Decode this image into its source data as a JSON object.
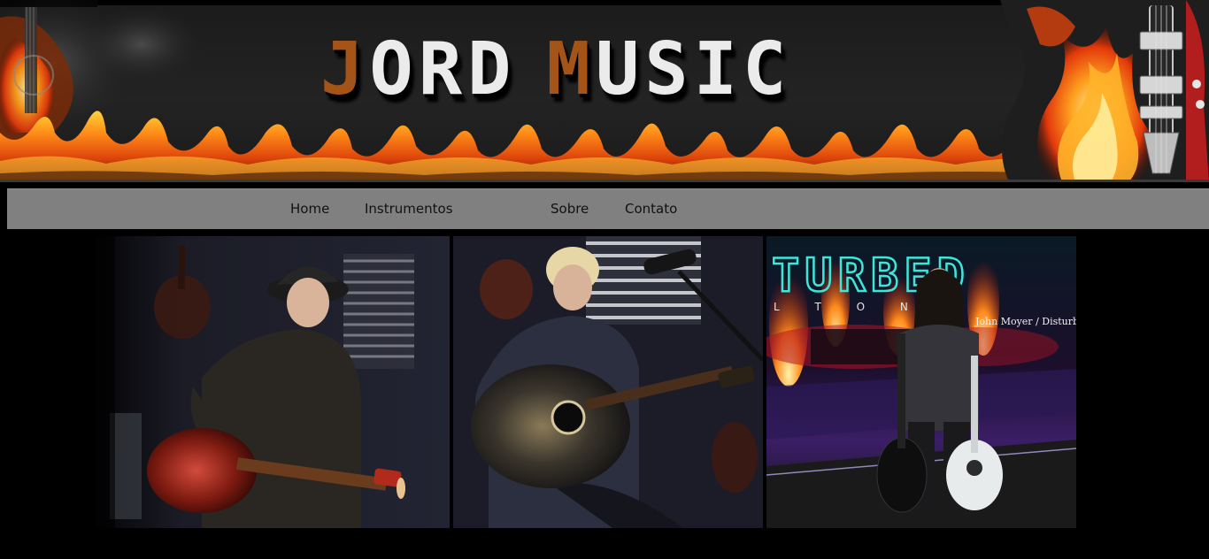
{
  "header": {
    "brand_word1_initial": "J",
    "brand_word1_rest": "ORD",
    "brand_word2_initial": "M",
    "brand_word2_rest": "USIC"
  },
  "nav": {
    "items": [
      {
        "label": "Home"
      },
      {
        "label": "Instrumentos"
      },
      {
        "label": "Sobre"
      },
      {
        "label": "Contato"
      }
    ]
  },
  "gallery": {
    "photos": [
      {
        "subject": "woman in hat playing red acoustic-electric guitar"
      },
      {
        "subject": "woman playing dark acoustic guitar at microphone"
      },
      {
        "subject": "bassist on stage holding two guitars",
        "sign_text": "TURBED",
        "sign_subtext": "L   T   O   N",
        "caption": "John Moyer / Disturbed"
      }
    ]
  },
  "colors": {
    "page_background": "#000000",
    "navbar_background": "#808080",
    "brand_text": "#ebebeb",
    "brand_accent": "#a45417",
    "flame_orange": "#ff7a12",
    "flame_yellow": "#ffd23a",
    "stage_teal": "#3ee6d9"
  }
}
